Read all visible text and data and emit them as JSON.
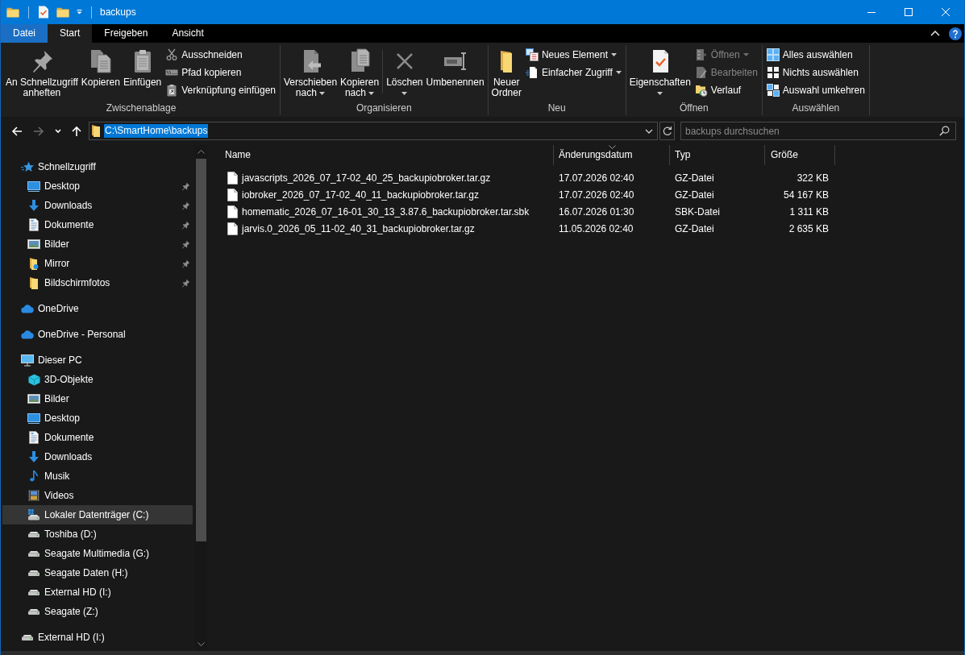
{
  "window": {
    "title": "backups"
  },
  "ribbon": {
    "tabs": [
      {
        "label": "Datei",
        "kind": "menu",
        "selected": false
      },
      {
        "label": "Start",
        "kind": "tab",
        "selected": true
      },
      {
        "label": "Freigeben",
        "kind": "tab",
        "selected": false
      },
      {
        "label": "Ansicht",
        "kind": "tab",
        "selected": false
      }
    ],
    "groups": [
      {
        "label": "Zwischenablage",
        "items": [
          {
            "kind": "large",
            "label": "An Schnellzugriff anheften",
            "dropdown": false,
            "disabled": false
          },
          {
            "kind": "large",
            "label": "Kopieren",
            "dropdown": false,
            "disabled": false
          },
          {
            "kind": "large",
            "label": "Einfügen",
            "dropdown": false,
            "disabled": false
          },
          {
            "kind": "small",
            "label": "Ausschneiden",
            "dropdown": false,
            "disabled": false
          },
          {
            "kind": "small",
            "label": "Pfad kopieren",
            "dropdown": false,
            "disabled": false
          },
          {
            "kind": "small",
            "label": "Verknüpfung einfügen",
            "dropdown": false,
            "disabled": false
          }
        ]
      },
      {
        "label": "Organisieren",
        "items": [
          {
            "kind": "large",
            "label": "Verschieben nach",
            "dropdown": true,
            "disabled": false
          },
          {
            "kind": "large",
            "label": "Kopieren nach",
            "dropdown": true,
            "disabled": false
          },
          {
            "kind": "separator"
          },
          {
            "kind": "large",
            "label": "Löschen",
            "dropdown": true,
            "disabled": false
          },
          {
            "kind": "large",
            "label": "Umbenennen",
            "dropdown": false,
            "disabled": false
          }
        ]
      },
      {
        "label": "Neu",
        "items": [
          {
            "kind": "large",
            "label": "Neuer Ordner",
            "dropdown": false,
            "disabled": false
          },
          {
            "kind": "small",
            "label": "Neues Element",
            "dropdown": true,
            "disabled": false
          },
          {
            "kind": "small",
            "label": "Einfacher Zugriff",
            "dropdown": true,
            "disabled": false
          }
        ]
      },
      {
        "label": "Öffnen",
        "items": [
          {
            "kind": "large",
            "label": "Eigenschaften",
            "dropdown": true,
            "disabled": false
          },
          {
            "kind": "small",
            "label": "Öffnen",
            "dropdown": true,
            "disabled": true
          },
          {
            "kind": "small",
            "label": "Bearbeiten",
            "dropdown": false,
            "disabled": true
          },
          {
            "kind": "small",
            "label": "Verlauf",
            "dropdown": false,
            "disabled": false
          }
        ]
      },
      {
        "label": "Auswählen",
        "items": [
          {
            "kind": "small",
            "label": "Alles auswählen",
            "dropdown": false,
            "disabled": false
          },
          {
            "kind": "small",
            "label": "Nichts auswählen",
            "dropdown": false,
            "disabled": false
          },
          {
            "kind": "small",
            "label": "Auswahl umkehren",
            "dropdown": false,
            "disabled": false
          }
        ]
      }
    ]
  },
  "navigation": [
    {
      "kind": "back",
      "disabled": false
    },
    {
      "kind": "forward",
      "disabled": true
    },
    {
      "kind": "recent",
      "disabled": false
    },
    {
      "kind": "up",
      "disabled": false
    }
  ],
  "address_bar": {
    "path": "C:\\SmartHome\\backups",
    "selected": true
  },
  "search": {
    "placeholder": "backups durchsuchen"
  },
  "sidebar": {
    "items": [
      {
        "label": "Schnellzugriff",
        "kind": "quickaccess",
        "selected": false,
        "children": [
          {
            "label": "Desktop",
            "kind": "desktop",
            "pinned": true,
            "selected": false
          },
          {
            "label": "Downloads",
            "kind": "downloads",
            "pinned": true,
            "selected": false
          },
          {
            "label": "Dokumente",
            "kind": "documents",
            "pinned": true,
            "selected": false
          },
          {
            "label": "Bilder",
            "kind": "pictures",
            "pinned": true,
            "selected": false
          },
          {
            "label": "Mirror",
            "kind": "mirror",
            "pinned": true,
            "selected": false
          },
          {
            "label": "Bildschirmfotos",
            "kind": "folder",
            "pinned": true,
            "selected": false
          }
        ]
      },
      {
        "label": "OneDrive",
        "kind": "cloud",
        "selected": false
      },
      {
        "label": "OneDrive - Personal",
        "kind": "cloud",
        "selected": false
      },
      {
        "label": "Dieser PC",
        "kind": "pc",
        "selected": false,
        "children": [
          {
            "label": "3D-Objekte",
            "kind": "objects",
            "selected": false
          },
          {
            "label": "Bilder",
            "kind": "pictures",
            "selected": false
          },
          {
            "label": "Desktop",
            "kind": "desktop",
            "selected": false
          },
          {
            "label": "Dokumente",
            "kind": "documents",
            "selected": false
          },
          {
            "label": "Downloads",
            "kind": "downloads",
            "selected": false
          },
          {
            "label": "Musik",
            "kind": "music",
            "selected": false
          },
          {
            "label": "Videos",
            "kind": "videos",
            "selected": false
          },
          {
            "label": "Lokaler Datenträger (C:)",
            "kind": "systemdrive",
            "selected": true
          },
          {
            "label": "Toshiba (D:)",
            "kind": "drive",
            "selected": false
          },
          {
            "label": "Seagate Multimedia (G:)",
            "kind": "drive",
            "selected": false
          },
          {
            "label": "Seagate Daten (H:)",
            "kind": "drive",
            "selected": false
          },
          {
            "label": "External HD (I:)",
            "kind": "drive",
            "selected": false
          },
          {
            "label": "Seagate (Z:)",
            "kind": "drive",
            "selected": false
          }
        ]
      },
      {
        "label": "External HD (I:)",
        "kind": "drive",
        "selected": false
      }
    ]
  },
  "file_list": {
    "columns": [
      {
        "label": "Name",
        "sorted": false
      },
      {
        "label": "Änderungsdatum",
        "sorted": true
      },
      {
        "label": "Typ",
        "sorted": false
      },
      {
        "label": "Größe",
        "sorted": false
      }
    ],
    "rows": [
      {
        "name": "javascripts_2026_07_17-02_40_25_backupiobroker.tar.gz",
        "modified": "17.07.2026 02:40",
        "type": "GZ-Datei",
        "size": "322 KB"
      },
      {
        "name": "iobroker_2026_07_17-02_40_11_backupiobroker.tar.gz",
        "modified": "17.07.2026 02:40",
        "type": "GZ-Datei",
        "size": "54 167 KB"
      },
      {
        "name": "homematic_2026_07_16-01_30_13_3.87.6_backupiobroker.tar.sbk",
        "modified": "16.07.2026 01:30",
        "type": "SBK-Datei",
        "size": "1 311 KB"
      },
      {
        "name": "jarvis.0_2026_05_11-02_40_31_backupiobroker.tar.gz",
        "modified": "11.05.2026 02:40",
        "type": "GZ-Datei",
        "size": "2 635 KB"
      }
    ]
  }
}
